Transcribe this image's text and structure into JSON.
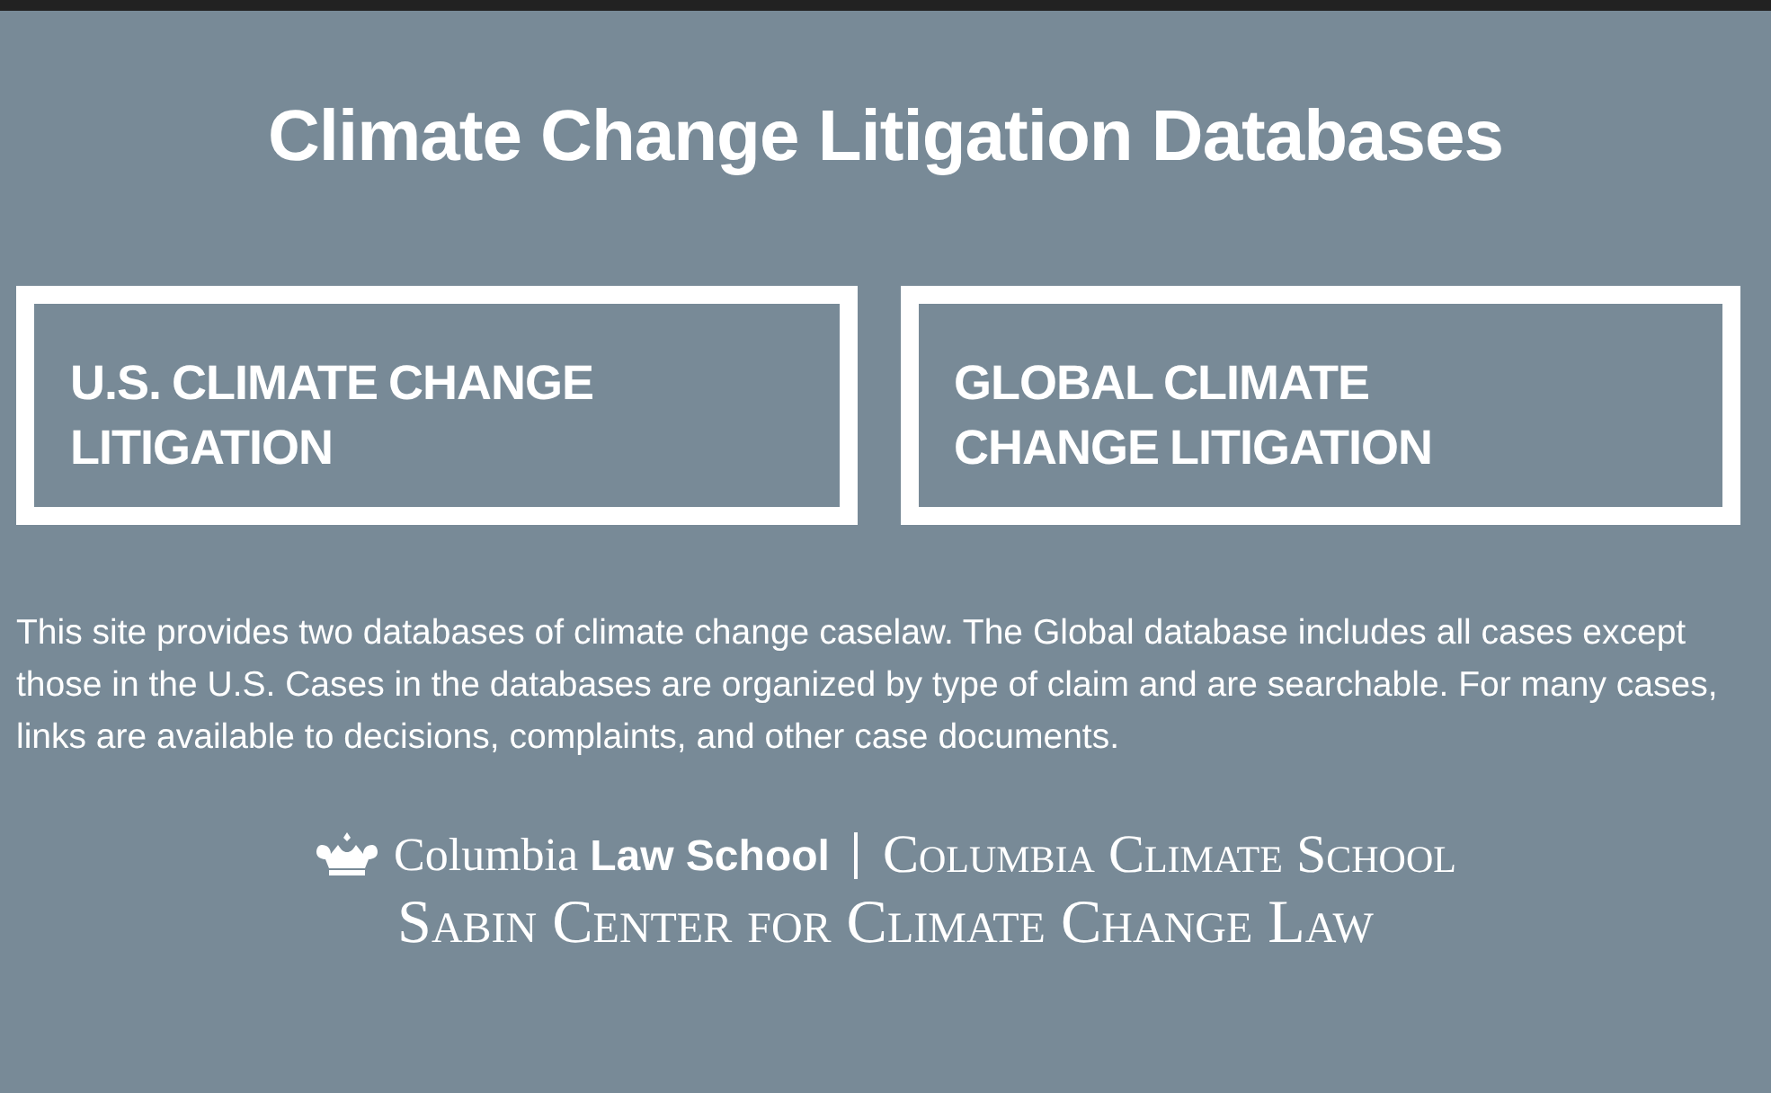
{
  "title": "Climate Change Litigation Databases",
  "databases": [
    {
      "label": "U.S. CLIMATE CHANGE LITIGATION"
    },
    {
      "label": "GLOBAL CLIMATE CHANGE LITIGATION"
    }
  ],
  "description": "This site provides two databases of climate change caselaw. The Global database includes all cases except those in the U.S.  Cases in the databases are organized by type of claim and are searchable. For many cases, links are available to decisions, complaints, and other case documents.",
  "footer": {
    "law_school": "Columbia **Law School**",
    "climate_school": "Columbia Climate School",
    "center": "Sabin Center for Climate Change Law"
  }
}
